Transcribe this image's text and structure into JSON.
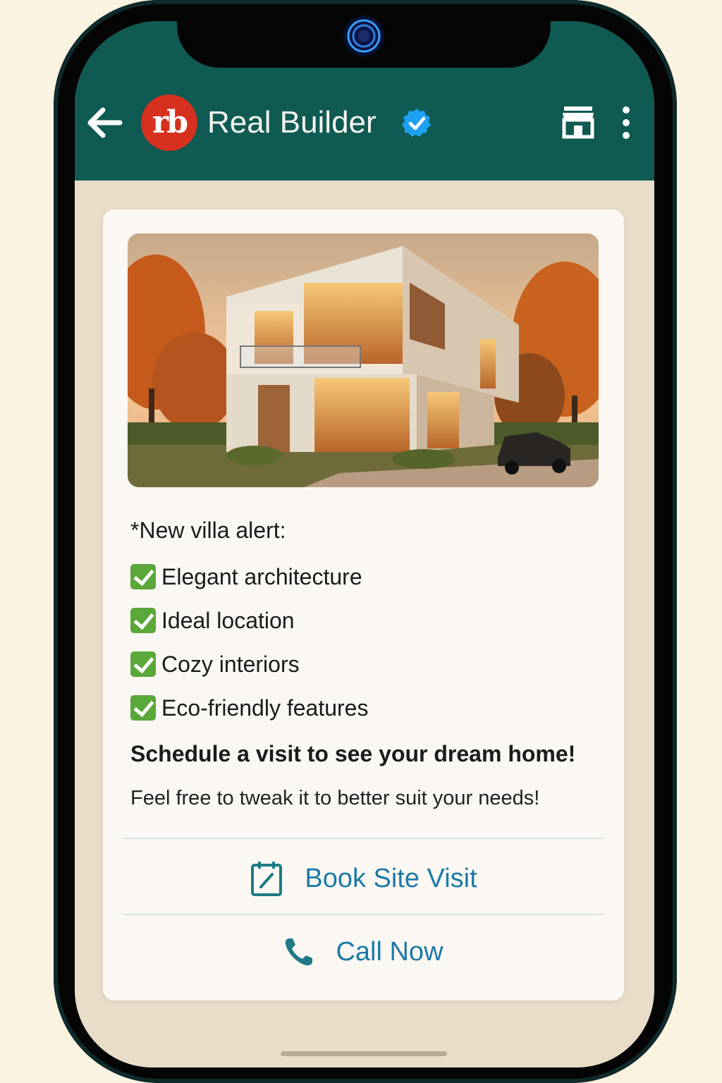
{
  "header": {
    "title": "Real Builder",
    "logo_text": "rb",
    "icons": [
      "back-arrow-icon",
      "verified-badge-icon",
      "store-icon",
      "more-vertical-icon"
    ],
    "color": "#0f5a52"
  },
  "message": {
    "image": "modern-villa-photo",
    "intro": "*New villa alert:",
    "features": [
      "Elegant architecture",
      "Ideal location",
      "Cozy interiors",
      "Eco-friendly features"
    ],
    "cta": "Schedule a visit to see your dream home!",
    "note": "Feel free to tweak it to better suit your needs!"
  },
  "actions": {
    "book_label": "Book Site Visit",
    "call_label": "Call Now",
    "color": "#1d7aa8"
  }
}
